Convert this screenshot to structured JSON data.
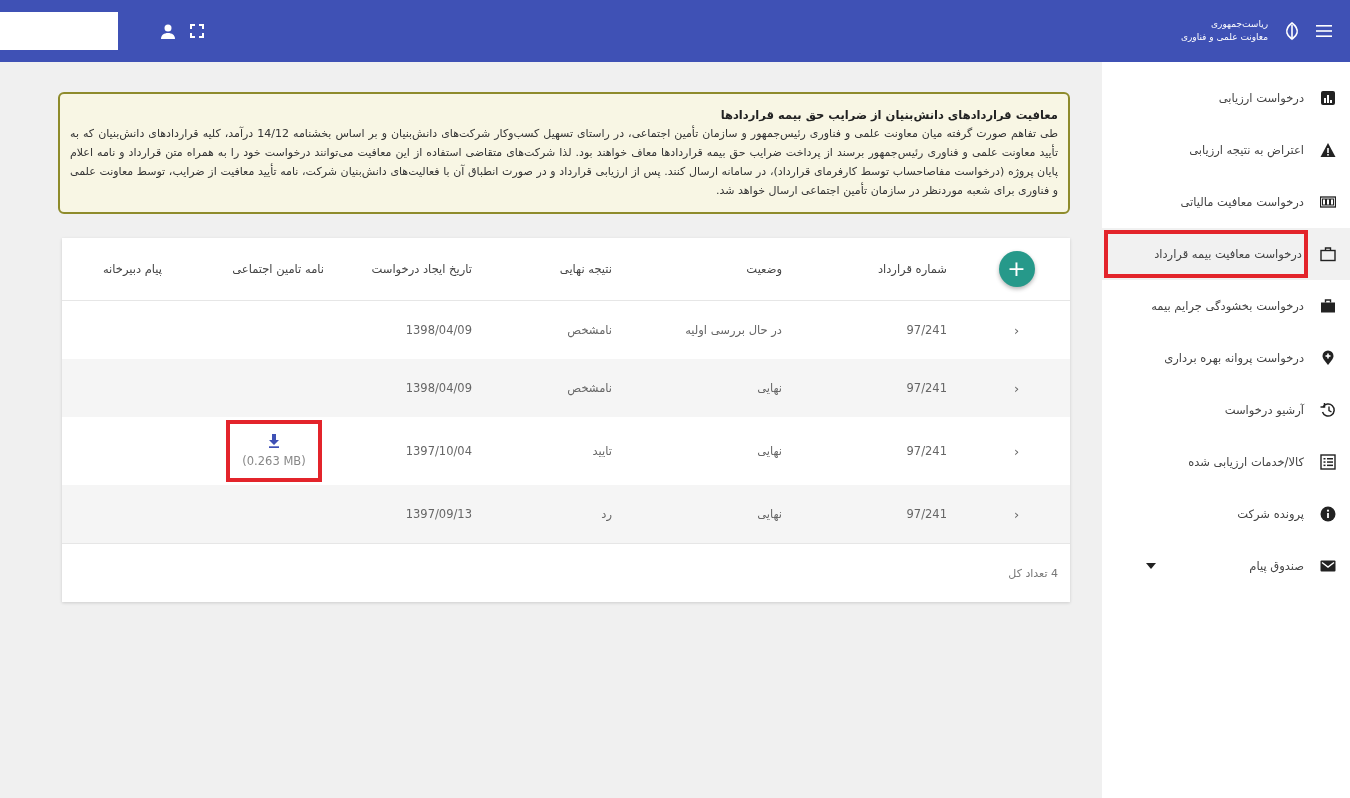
{
  "header": {
    "brand_line_1": "ریاست‌جمهوری",
    "brand_line_2": "معاونت علمی و فناوری"
  },
  "sidebar": {
    "items": [
      {
        "label": "درخواست ارزیابی",
        "selected": false
      },
      {
        "label": "اعتراض به نتیجه ارزیابی",
        "selected": false
      },
      {
        "label": "درخواست معافیت مالیاتی",
        "selected": false
      },
      {
        "label": "درخواست معافیت بیمه قرارداد",
        "selected": true,
        "highlighted": true
      },
      {
        "label": "درخواست بخشودگی جرایم بیمه",
        "selected": false
      },
      {
        "label": "درخواست پروانه بهره برداری",
        "selected": false
      },
      {
        "label": "آرشیو درخواست",
        "selected": false
      },
      {
        "label": "کالا/خدمات ارزیابی شده",
        "selected": false
      },
      {
        "label": "پرونده شرکت",
        "selected": false
      },
      {
        "label": "صندوق پیام",
        "selected": false,
        "expanded": false
      }
    ]
  },
  "notice": {
    "title": "معافیت قراردادهای دانش‌بنیان از ضرایب حق بیمه قراردادها",
    "body": "طی تفاهم صورت گرفته میان معاونت علمی و فناوری رئیس‌جمهور و سازمان تأمین اجتماعی، در راستای تسهیل کسب‌وکار شرکت‌های دانش‌بنیان و بر اساس بخشنامه 14/12 درآمد، کلیه قراردادهای دانش‌بنیان که به تأیید معاونت علمی و فناوری رئیس‌جمهور برسند از پرداخت ضرایب حق بیمه قراردادها معاف خواهند بود. لذا شرکت‌های متقاضی استفاده از این معافیت می‌توانند درخواست خود را به همراه متن قرارداد و نامه اعلام پایان پروژه (درخواست مفاصاحساب توسط کارفرمای قرارداد)، در سامانه ارسال کنند. پس از ارزیابی قرارداد و در صورت انطباق آن با فعالیت‌های دانش‌بنیان شرکت، نامه تأیید معافیت از ضرایب، توسط معاونت علمی و فناوری برای شعبه موردنظر در سازمان تأمین اجتماعی ارسال خواهد شد."
  },
  "table": {
    "add_button": "+",
    "columns": [
      "شماره قرارداد",
      "وضعیت",
      "نتیجه نهایی",
      "تاریخ ایجاد درخواست",
      "نامه تامین اجتماعی",
      "پیام دبیرخانه"
    ],
    "rows": [
      {
        "expander": "‹",
        "contract_number": "97/241",
        "status": "در حال بررسی اولیه",
        "final_result": "نامشخص",
        "created_date": "1398/04/09"
      },
      {
        "expander": "‹",
        "contract_number": "97/241",
        "status": "نهایی",
        "final_result": "نامشخص",
        "created_date": "1398/04/09"
      },
      {
        "expander": "‹",
        "contract_number": "97/241",
        "status": "نهایی",
        "final_result": "تایید",
        "created_date": "1397/10/04",
        "letter_file": {
          "size": "(0.263 MB)",
          "highlighted": true
        }
      },
      {
        "expander": "‹",
        "contract_number": "97/241",
        "status": "نهایی",
        "final_result": "رد",
        "created_date": "1397/09/13"
      }
    ],
    "total": "4 تعداد کل"
  }
}
